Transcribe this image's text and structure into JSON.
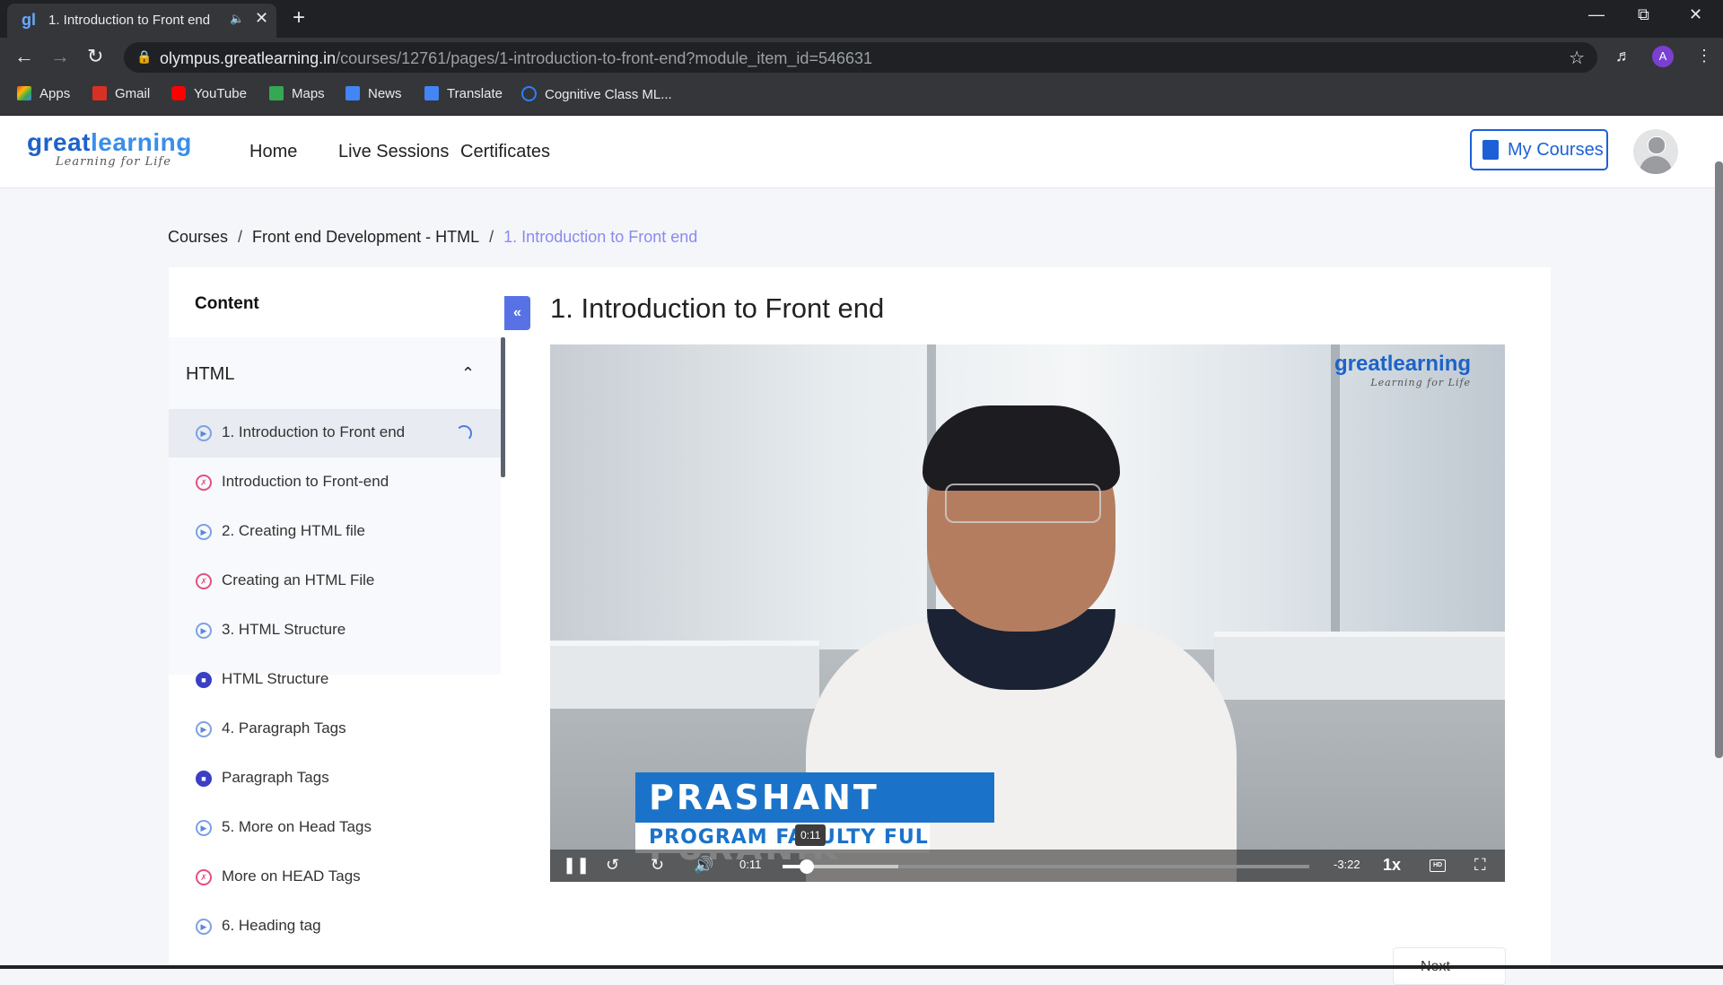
{
  "browser": {
    "tab_title": "1. Introduction to Front end",
    "tab_favicon": "gl",
    "url_host": "olympus.greatlearning.in",
    "url_path": "/courses/12761/pages/1-introduction-to-front-end?module_item_id=546631",
    "profile_initial": "A",
    "bookmarks": [
      {
        "label": "Apps",
        "color": "#ea4335"
      },
      {
        "label": "Gmail",
        "color": "#d93025"
      },
      {
        "label": "YouTube",
        "color": "#ff0000"
      },
      {
        "label": "Maps",
        "color": "#34a853"
      },
      {
        "label": "News",
        "color": "#4285f4"
      },
      {
        "label": "Translate",
        "color": "#4285f4"
      },
      {
        "label": "Cognitive Class ML...",
        "color": "#2d7ff9"
      }
    ]
  },
  "site": {
    "logo_main": "great",
    "logo_accent": "learning",
    "logo_tagline": "Learning for Life",
    "nav": [
      "Home",
      "Live Sessions",
      "Certificates"
    ],
    "my_courses": "My Courses",
    "accent_color": "#1d5fd6"
  },
  "breadcrumb": {
    "items": [
      "Courses",
      "Front end Development - HTML"
    ],
    "current": "1. Introduction to Front end",
    "separator": "/"
  },
  "sidebar": {
    "title": "Content",
    "section": "HTML",
    "items": [
      {
        "label": "1. Introduction to Front end",
        "icon": "play",
        "active": true
      },
      {
        "label": "Introduction to Front-end",
        "icon": "recording"
      },
      {
        "label": "2. Creating HTML file",
        "icon": "play"
      },
      {
        "label": "Creating an HTML File",
        "icon": "recording"
      },
      {
        "label": "3. HTML Structure",
        "icon": "play"
      },
      {
        "label": "HTML Structure",
        "icon": "document"
      },
      {
        "label": "4. Paragraph Tags",
        "icon": "play"
      },
      {
        "label": "Paragraph Tags",
        "icon": "document"
      },
      {
        "label": "5. More on Head Tags",
        "icon": "play"
      },
      {
        "label": "More on HEAD Tags",
        "icon": "recording"
      },
      {
        "label": "6. Heading tag",
        "icon": "play"
      }
    ]
  },
  "lesson": {
    "title": "1. Introduction to Front end"
  },
  "video": {
    "watermark_main": "greatlearning",
    "watermark_tagline": "Learning for Life",
    "lower_third_name": "PRASHANT PURANIK",
    "lower_third_role": "PROGRAM FACULTY FULL STACK",
    "tooltip_time": "0:11",
    "current_time": "0:11",
    "remaining_time": "-3:22",
    "speed": "1x",
    "hd_label": "HD",
    "progress_fraction": 0.046,
    "buffered_fraction": 0.22
  },
  "next_label": "Next"
}
